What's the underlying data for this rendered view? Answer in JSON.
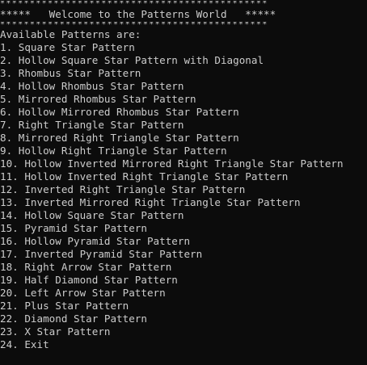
{
  "console": {
    "border_top": "*********************************************",
    "title": "*****   Welcome to the Patterns World   *****",
    "border_bottom": "*********************************************",
    "heading": "Available Patterns are:",
    "items": [
      "1. Square Star Pattern",
      "2. Hollow Square Star Pattern with Diagonal",
      "3. Rhombus Star Pattern",
      "4. Hollow Rhombus Star Pattern",
      "5. Mirrored Rhombus Star Pattern",
      "6. Hollow Mirrored Rhombus Star Pattern",
      "7. Right Triangle Star Pattern",
      "8. Mirrored Right Triangle Star Pattern",
      "9. Hollow Right Triangle Star Pattern",
      "10. Hollow Inverted Mirrored Right Triangle Star Pattern",
      "11. Hollow Inverted Right Triangle Star Pattern",
      "12. Inverted Right Triangle Star Pattern",
      "13. Inverted Mirrored Right Triangle Star Pattern",
      "14. Hollow Square Star Pattern",
      "15. Pyramid Star Pattern",
      "16. Hollow Pyramid Star Pattern",
      "17. Inverted Pyramid Star Pattern",
      "18. Right Arrow Star Pattern",
      "19. Half Diamond Star Pattern",
      "20. Left Arrow Star Pattern",
      "21. Plus Star Pattern",
      "22. Diamond Star Pattern",
      "23. X Star Pattern",
      "24. Exit"
    ]
  }
}
